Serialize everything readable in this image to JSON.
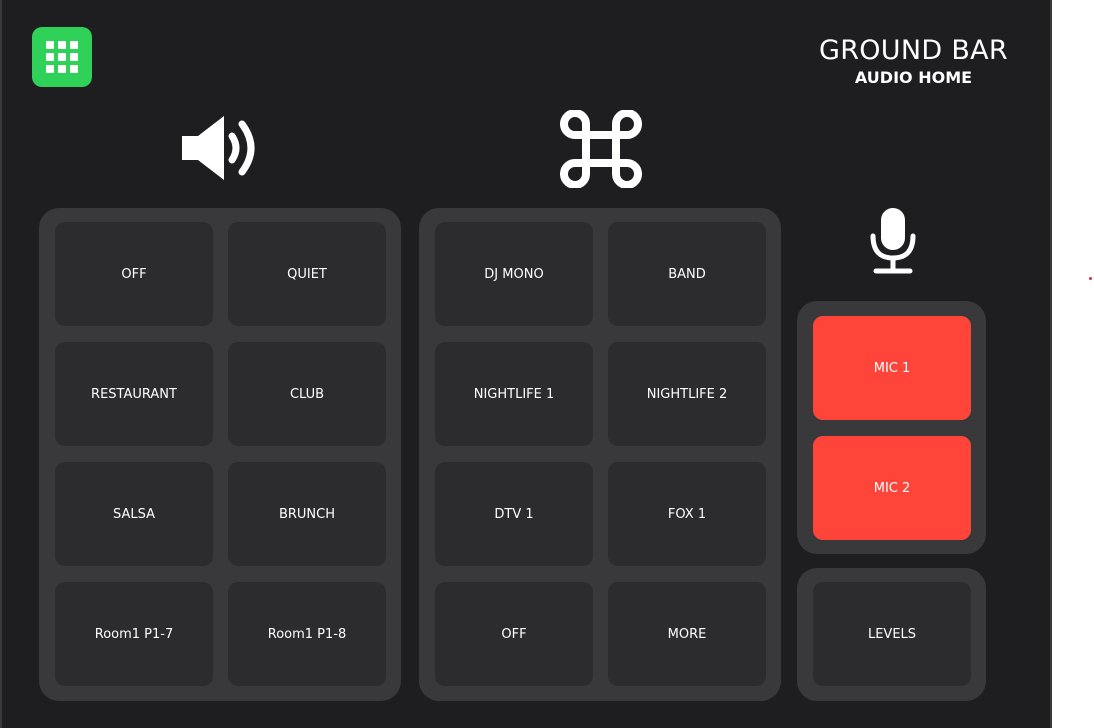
{
  "header": {
    "title": "GROUND BAR",
    "subtitle": "AUDIO HOME"
  },
  "icons": {
    "apps": "apps-grid-icon",
    "volume": "speaker-volume-icon",
    "source": "command-key-icon",
    "mic": "microphone-icon"
  },
  "colors": {
    "background": "#1e1e20",
    "group": "#39393b",
    "button": "#2c2c2e",
    "apps_button": "#30d158",
    "mic_button": "#ff453a"
  },
  "presets": [
    {
      "label": "OFF"
    },
    {
      "label": "QUIET"
    },
    {
      "label": "RESTAURANT"
    },
    {
      "label": "CLUB"
    },
    {
      "label": "SALSA"
    },
    {
      "label": "BRUNCH"
    },
    {
      "label": "Room1 P1-7"
    },
    {
      "label": "Room1 P1-8"
    }
  ],
  "sources": [
    {
      "label": "DJ MONO"
    },
    {
      "label": "BAND"
    },
    {
      "label": "NIGHTLIFE 1"
    },
    {
      "label": "NIGHTLIFE 2"
    },
    {
      "label": "DTV 1"
    },
    {
      "label": "FOX 1"
    },
    {
      "label": "OFF"
    },
    {
      "label": "MORE"
    }
  ],
  "mics": [
    {
      "label": "MIC 1"
    },
    {
      "label": "MIC 2"
    }
  ],
  "levels": {
    "label": "LEVELS"
  }
}
